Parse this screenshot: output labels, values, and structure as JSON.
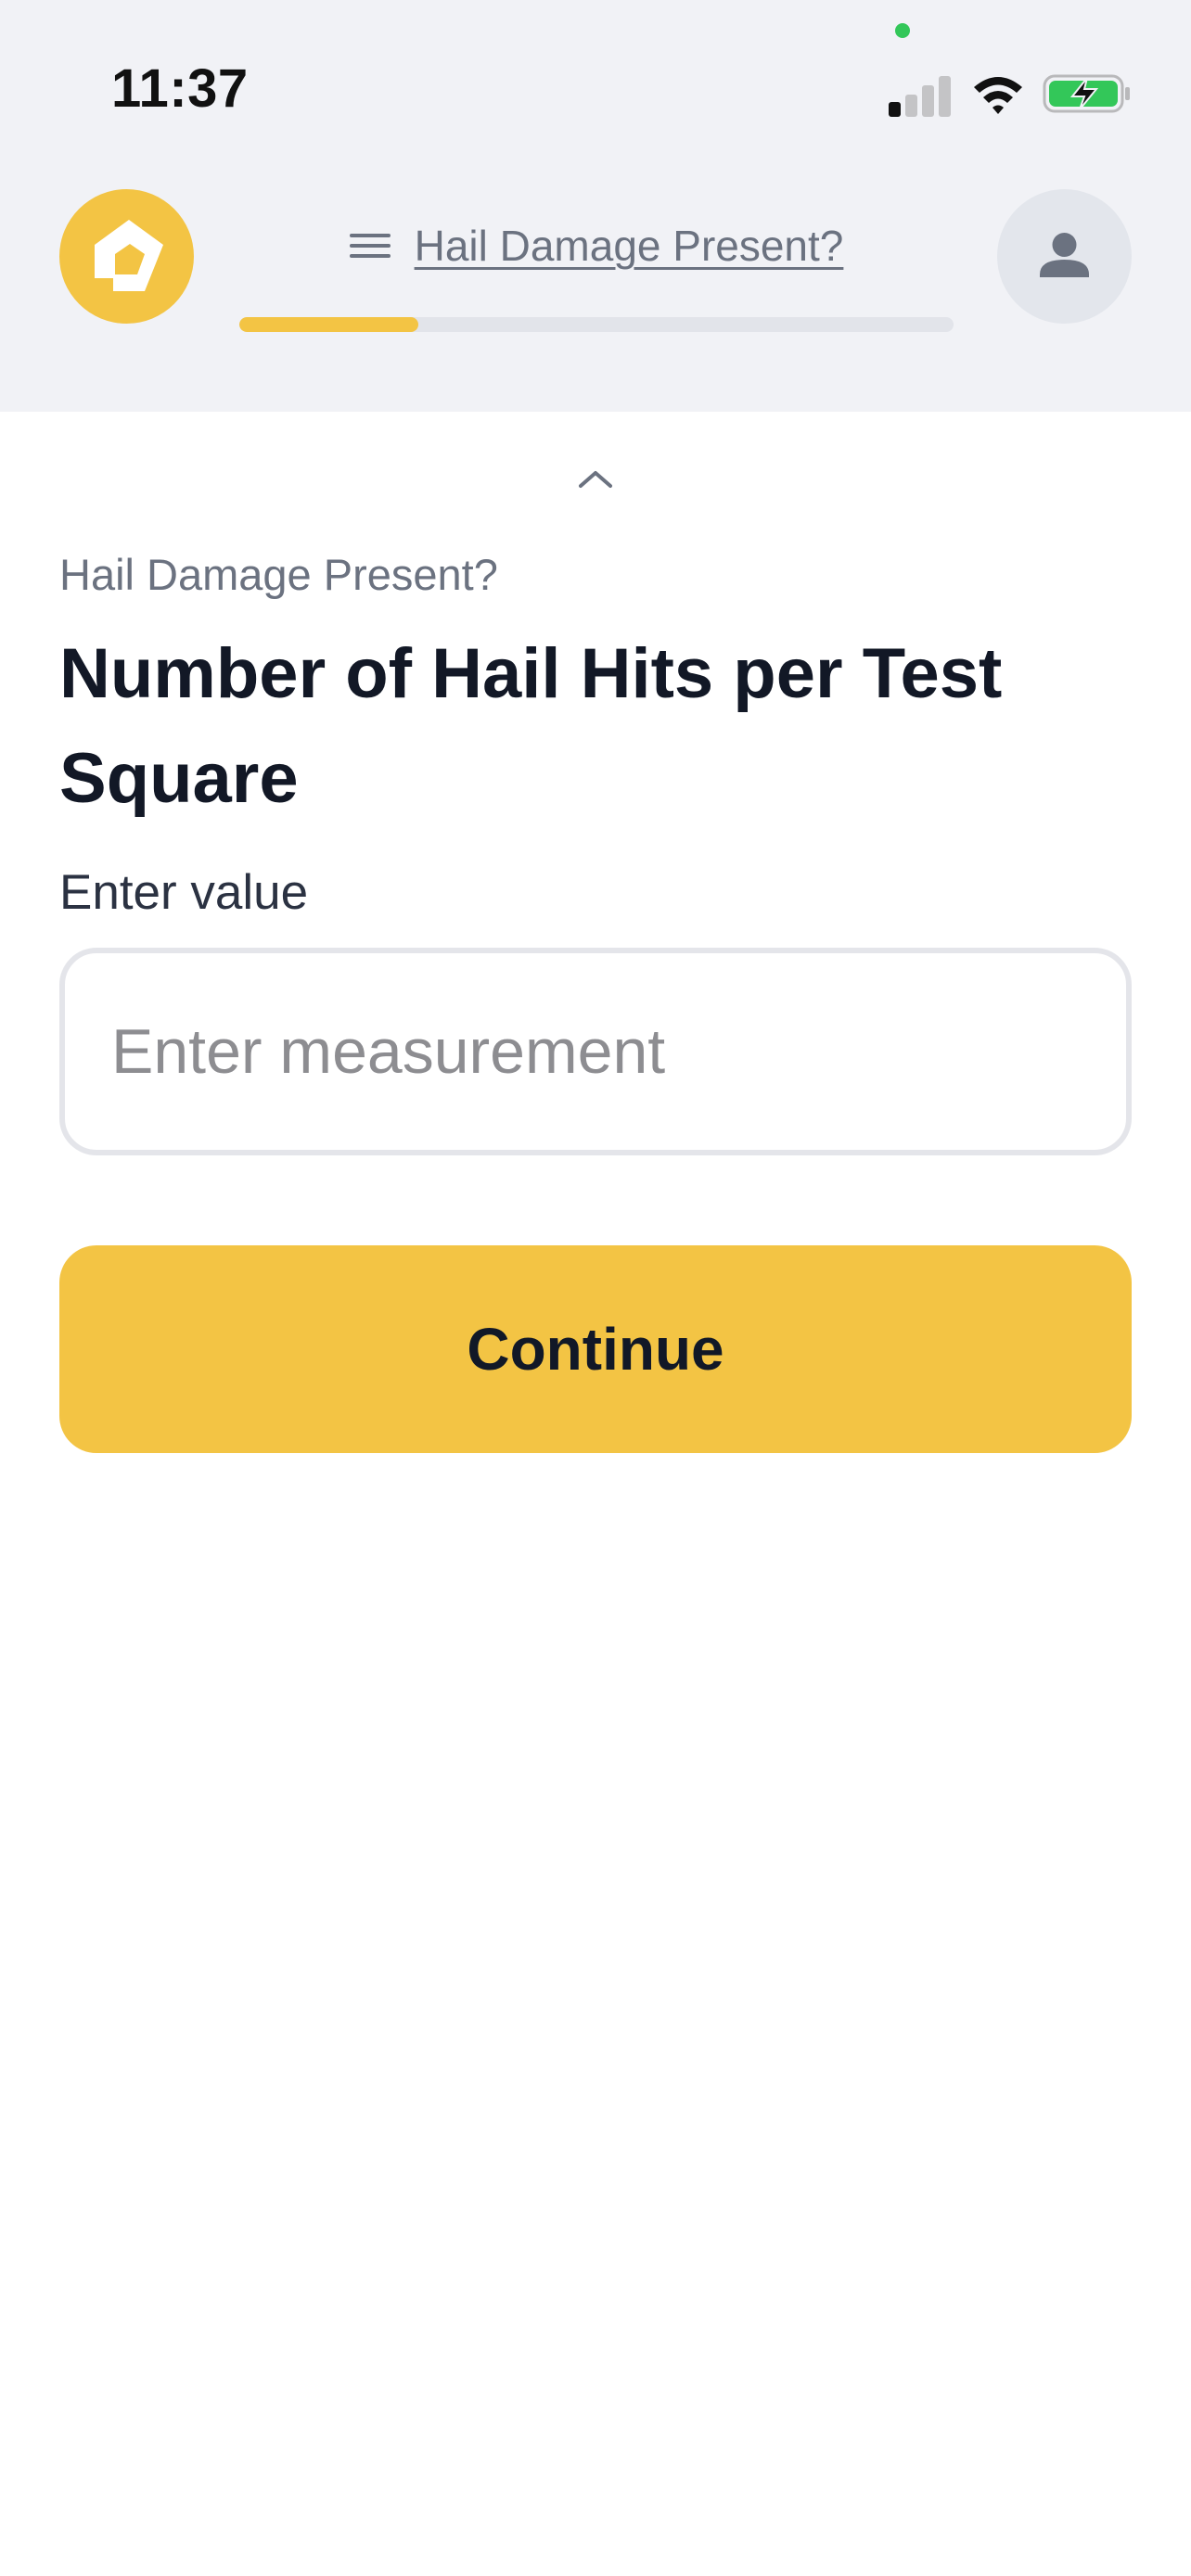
{
  "status_bar": {
    "time": "11:37",
    "signal_icon": "cellular-signal-icon",
    "wifi_icon": "wifi-icon",
    "battery_icon": "battery-charging-icon",
    "battery_color": "#33c759"
  },
  "header": {
    "logo_icon": "house-logo-icon",
    "menu_icon": "hamburger-menu-icon",
    "title": "Hail Damage Present?",
    "progress": 0.25,
    "avatar_icon": "user-icon"
  },
  "main": {
    "collapse_icon": "chevron-up-icon",
    "breadcrumb": "Hail Damage Present?",
    "title": "Number of Hail Hits per Test Square",
    "field_label": "Enter value",
    "input_value": "",
    "input_placeholder": "Enter measurement",
    "continue_label": "Continue"
  },
  "colors": {
    "accent": "#f3c444",
    "header_bg": "#f1f2f6",
    "muted_text": "#6b7280",
    "title_text": "#121826"
  }
}
